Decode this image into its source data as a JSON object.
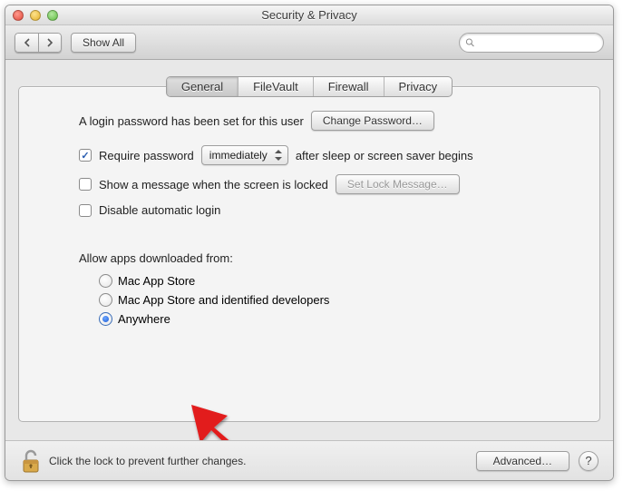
{
  "window": {
    "title": "Security & Privacy"
  },
  "toolbar": {
    "show_all": "Show All",
    "search_placeholder": ""
  },
  "tabs": [
    "General",
    "FileVault",
    "Firewall",
    "Privacy"
  ],
  "general": {
    "login_password_text": "A login password has been set for this user",
    "change_password": "Change Password…",
    "require_password_label": "Require password",
    "require_password_when": "immediately",
    "require_password_after": "after sleep or screen saver begins",
    "show_message_label": "Show a message when the screen is locked",
    "set_lock_message": "Set Lock Message…",
    "disable_autologin": "Disable automatic login",
    "allow_apps_label": "Allow apps downloaded from:",
    "options": {
      "mas": "Mac App Store",
      "mas_dev": "Mac App Store and identified developers",
      "anywhere": "Anywhere"
    },
    "selected": "anywhere",
    "require_password_checked": true,
    "show_message_checked": false,
    "disable_autologin_checked": false
  },
  "footer": {
    "lock_text": "Click the lock to prevent further changes.",
    "advanced": "Advanced…",
    "help": "?"
  }
}
